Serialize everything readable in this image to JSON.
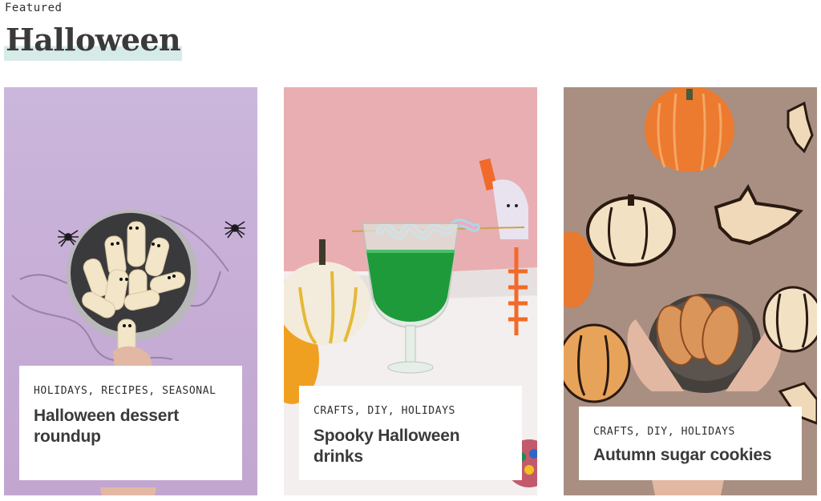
{
  "section": {
    "eyebrow": "Featured",
    "title": "Halloween"
  },
  "cards": [
    {
      "tags": [
        "HOLIDAYS",
        "RECIPES",
        "SEASONAL"
      ],
      "title": "Halloween dessert roundup",
      "image_icon": "mummy-cookies-photo",
      "background_color": "#c9b1d6"
    },
    {
      "tags": [
        "CRAFTS",
        "DIY",
        "HOLIDAYS"
      ],
      "title": "Spooky Halloween drinks",
      "image_icon": "green-drink-photo",
      "background_color": "#e8aeb0"
    },
    {
      "tags": [
        "CRAFTS",
        "DIY",
        "HOLIDAYS"
      ],
      "title": "Autumn sugar cookies",
      "image_icon": "pumpkin-cookies-photo",
      "background_color": "#a68e80"
    }
  ],
  "colors": {
    "title_highlight": "#d6ebe8",
    "text": "#2b2b2b"
  }
}
